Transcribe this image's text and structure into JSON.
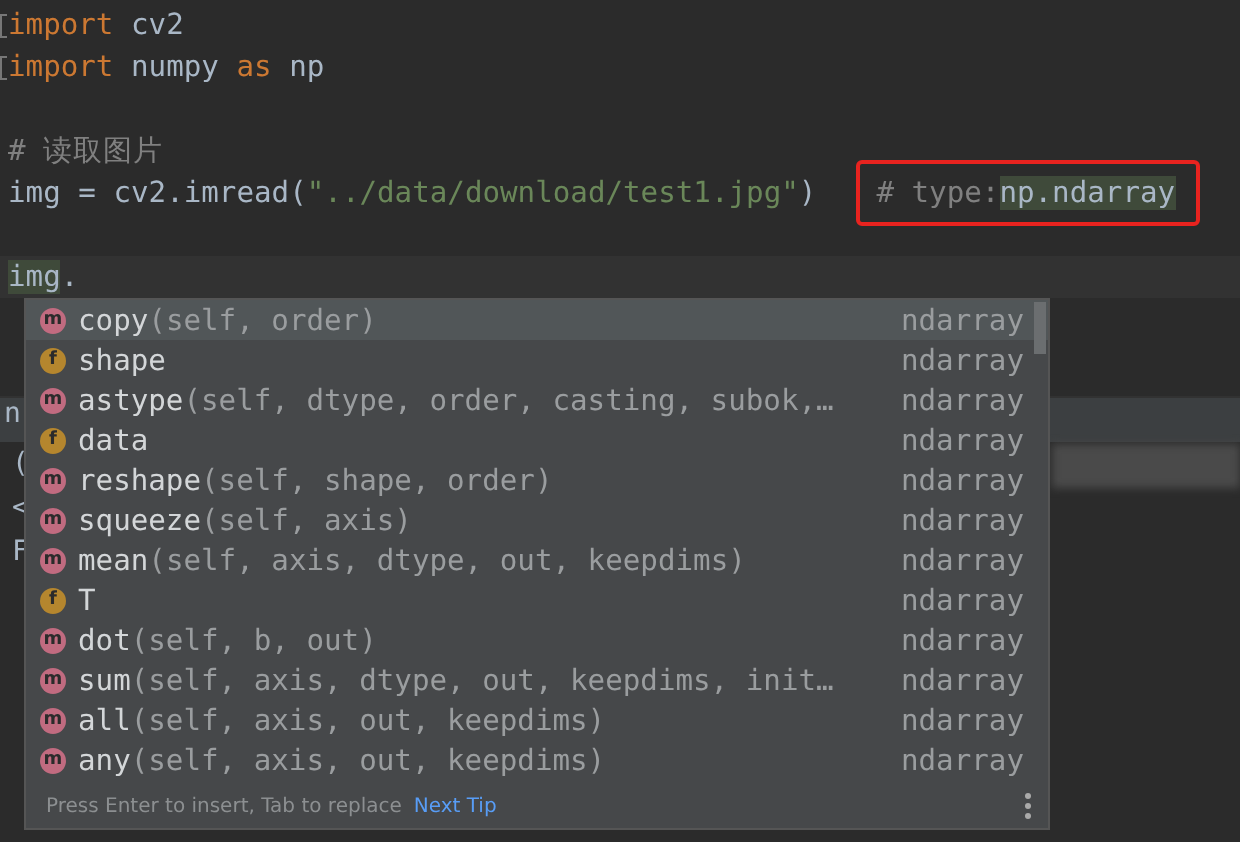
{
  "editor": {
    "lines": [
      {
        "kind": "code",
        "tokens": [
          {
            "kind": "keyword",
            "text": "import"
          },
          {
            "kind": "plain",
            "text": " cv2"
          }
        ],
        "folded": true
      },
      {
        "kind": "code",
        "tokens": [
          {
            "kind": "keyword",
            "text": "import"
          },
          {
            "kind": "plain",
            "text": " numpy "
          },
          {
            "kind": "keyword",
            "text": "as"
          },
          {
            "kind": "plain",
            "text": " np"
          }
        ],
        "folded": true
      },
      {
        "kind": "blank"
      },
      {
        "kind": "code",
        "tokens": [
          {
            "kind": "comment",
            "text": "# 读取图片"
          }
        ]
      },
      {
        "kind": "code",
        "tokens": [
          {
            "kind": "plain",
            "text": "img = cv2.imread("
          },
          {
            "kind": "string",
            "text": "\"../data/download/test1.jpg\""
          },
          {
            "kind": "plain",
            "text": ")"
          }
        ],
        "annotation": [
          {
            "kind": "comment",
            "text": "# type:"
          },
          {
            "kind": "match",
            "text": "np.ndarray"
          }
        ]
      },
      {
        "kind": "blank"
      },
      {
        "kind": "code",
        "tokens": [
          {
            "kind": "match",
            "text": "img"
          },
          {
            "kind": "plain",
            "text": "."
          }
        ],
        "current": true
      }
    ]
  },
  "tool_window": {
    "fragments": [
      "n",
      "(",
      "<",
      "F"
    ]
  },
  "completion": {
    "items": [
      {
        "kind": "method",
        "icon": "m",
        "name": "copy",
        "params": "(self, order)",
        "type": "ndarray",
        "selected": true
      },
      {
        "kind": "field",
        "icon": "f",
        "name": "shape",
        "type": "ndarray",
        "selected": false
      },
      {
        "kind": "method",
        "icon": "m",
        "name": "astype",
        "params": "(self, dtype, order, casting, subok,…",
        "type": "ndarray",
        "selected": false
      },
      {
        "kind": "field",
        "icon": "f",
        "name": "data",
        "type": "ndarray",
        "selected": false
      },
      {
        "kind": "method",
        "icon": "m",
        "name": "reshape",
        "params": "(self, shape, order)",
        "type": "ndarray",
        "selected": false
      },
      {
        "kind": "method",
        "icon": "m",
        "name": "squeeze",
        "params": "(self, axis)",
        "type": "ndarray",
        "selected": false
      },
      {
        "kind": "method",
        "icon": "m",
        "name": "mean",
        "params": "(self, axis, dtype, out, keepdims)",
        "type": "ndarray",
        "selected": false
      },
      {
        "kind": "field",
        "icon": "f",
        "name": "T",
        "type": "ndarray",
        "selected": false
      },
      {
        "kind": "method",
        "icon": "m",
        "name": "dot",
        "params": "(self, b, out)",
        "type": "ndarray",
        "selected": false
      },
      {
        "kind": "method",
        "icon": "m",
        "name": "sum",
        "params": "(self, axis, dtype, out, keepdims, init…",
        "type": "ndarray",
        "selected": false
      },
      {
        "kind": "method",
        "icon": "m",
        "name": "all",
        "params": "(self, axis, out, keepdims)",
        "type": "ndarray",
        "selected": false
      },
      {
        "kind": "method",
        "icon": "m",
        "name": "any",
        "params": "(self, axis, out, keepdims)",
        "type": "ndarray",
        "selected": false
      }
    ],
    "hint": "Press Enter to insert, Tab to replace",
    "link": "Next Tip"
  }
}
